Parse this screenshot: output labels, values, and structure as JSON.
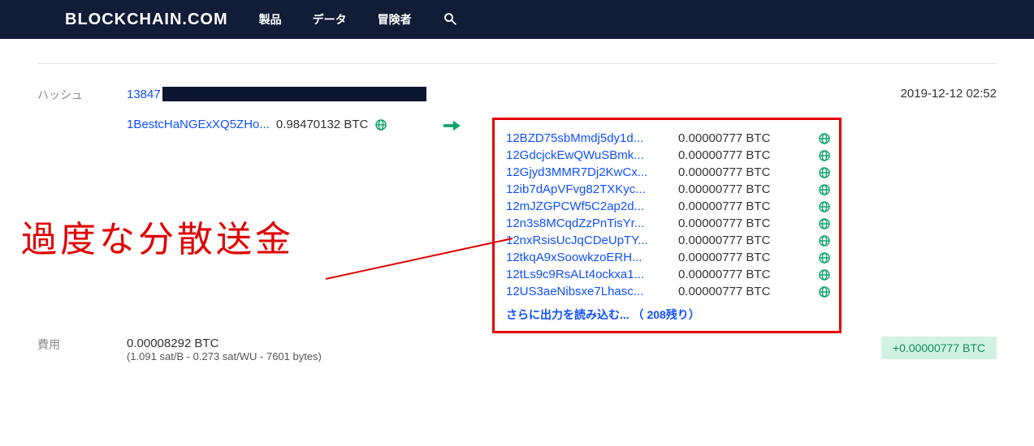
{
  "brand": "BLOCKCHAIN.COM",
  "nav": {
    "products": "製品",
    "data": "データ",
    "explorer": "冒険者"
  },
  "labels": {
    "hash": "ハッシュ",
    "fee": "費用"
  },
  "tx": {
    "hash_prefix": "13847",
    "timestamp": "2019-12-12 02:52",
    "input": {
      "address": "1BestcHaNGExXQ5ZHo...",
      "amount": "0.98470132 BTC"
    },
    "outputs": [
      {
        "address": "12BZD75sbMmdj5dy1d...",
        "amount": "0.00000777 BTC"
      },
      {
        "address": "12GdcjckEwQWuSBmk...",
        "amount": "0.00000777 BTC"
      },
      {
        "address": "12Gjyd3MMR7Dj2KwCx...",
        "amount": "0.00000777 BTC"
      },
      {
        "address": "12ib7dApVFvg82TXKyc...",
        "amount": "0.00000777 BTC"
      },
      {
        "address": "12mJZGPCWf5C2ap2d...",
        "amount": "0.00000777 BTC"
      },
      {
        "address": "12n3s8MCqdZzPnTisYr...",
        "amount": "0.00000777 BTC"
      },
      {
        "address": "12nxRsisUcJqCDeUpTY...",
        "amount": "0.00000777 BTC"
      },
      {
        "address": "12tkqA9xSoowkzoERH...",
        "amount": "0.00000777 BTC"
      },
      {
        "address": "12tLs9c9RsALt4ockxa1...",
        "amount": "0.00000777 BTC"
      },
      {
        "address": "12US3aeNibsxe7Lhasc...",
        "amount": "0.00000777 BTC"
      }
    ],
    "load_more": "さらに出力を読み込む... （ 208残り）",
    "fee": {
      "amount": "0.00008292 BTC",
      "detail": "(1.091 sat/B - 0.273 sat/WU - 7601 bytes)"
    },
    "net": "+0.00000777 BTC"
  },
  "annotation": "過度な分散送金"
}
